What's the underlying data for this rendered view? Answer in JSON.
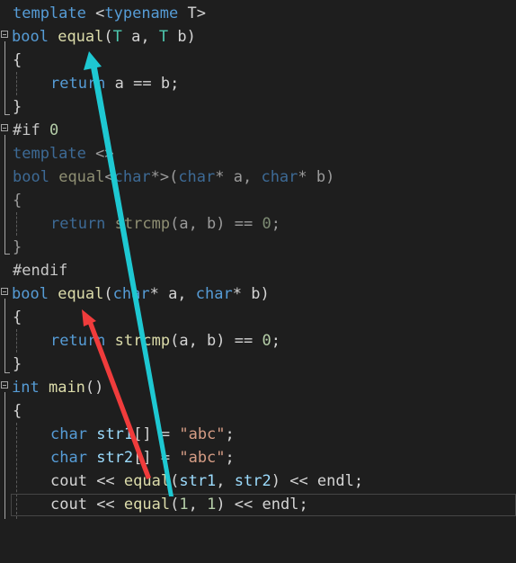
{
  "code_lines": [
    "template <typename T>",
    "bool equal(T a, T b)",
    "{",
    "return a == b;",
    "}",
    "#if 0",
    "template <>",
    "bool equal<char*>(char* a, char* b)",
    "{",
    "return strcmp(a, b) == 0;",
    "}",
    "#endif",
    "bool equal(char* a, char* b)",
    "{",
    "return strcmp(a, b) == 0;",
    "}",
    "int main()",
    "{",
    "char str1[] = \"abc\";",
    "char str2[] = \"abc\";",
    "cout << equal(str1, str2) << endl;",
    "cout << equal(1, 1) << endl;"
  ],
  "tokens": {
    "l0": [
      "template",
      " <",
      "typename",
      " T>"
    ],
    "l1": [
      "bool",
      " ",
      "equal",
      "(",
      "T",
      " a, ",
      "T",
      " b)"
    ],
    "l2": [
      "{"
    ],
    "l3": [
      "return",
      " a == b;"
    ],
    "l4": [
      "}"
    ],
    "l5": [
      "#if",
      " ",
      "0"
    ],
    "l6": [
      "template",
      " <>"
    ],
    "l7": [
      "bool",
      " ",
      "equal",
      "<",
      "char",
      "*>(",
      "char",
      "* a, ",
      "char",
      "* b)"
    ],
    "l8": [
      "{"
    ],
    "l9": [
      "return",
      " ",
      "strcmp",
      "(a, b) == ",
      "0",
      ";"
    ],
    "l10": [
      "}"
    ],
    "l11": [
      "#endif"
    ],
    "l12": [
      "bool",
      " ",
      "equal",
      "(",
      "char",
      "* a, ",
      "char",
      "* b)"
    ],
    "l13": [
      "{"
    ],
    "l14": [
      "return",
      " ",
      "strcmp",
      "(a, b) == ",
      "0",
      ";"
    ],
    "l15": [
      "}"
    ],
    "l16": [
      "int",
      " ",
      "main",
      "()"
    ],
    "l17": [
      "{"
    ],
    "l18": [
      "char",
      " ",
      "str1",
      "[] = ",
      "\"abc\"",
      ";"
    ],
    "l19": [
      "char",
      " ",
      "str2",
      "[] = ",
      "\"abc\"",
      ";"
    ],
    "l20": [
      "cout",
      " << ",
      "equal",
      "(",
      "str1",
      ", ",
      "str2",
      ") << ",
      "endl",
      ";"
    ],
    "l21": [
      "cout",
      " << ",
      "equal",
      "(",
      "1",
      ", ",
      "1",
      ") << ",
      "endl",
      ";"
    ]
  },
  "colors": {
    "background": "#1e1e1e",
    "keyword": "#569cd6",
    "function": "#dcdcaa",
    "type_param": "#4ec9b0",
    "string": "#d69d85",
    "number": "#b5cea8",
    "arrow_cyan": "#1ec8d2",
    "arrow_red": "#f03c3c"
  },
  "annotations": {
    "cyan_arrow": "points from equal(1, 1) call to the template equal(T a, T b)",
    "red_arrow": "points from equal(str1, str2) call to bool equal(char* a, char* b)"
  }
}
